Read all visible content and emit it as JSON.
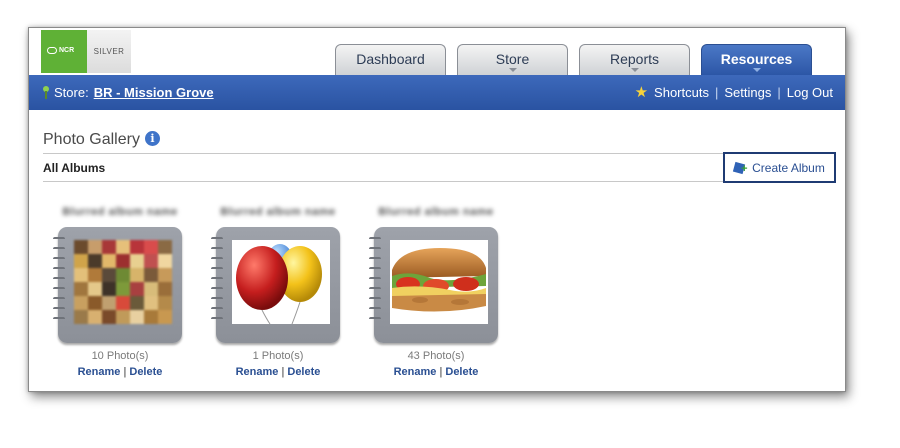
{
  "brand": {
    "logo_primary": "NCR",
    "logo_secondary": "SILVER"
  },
  "tabs": [
    {
      "label": "Dashboard",
      "active": false,
      "has_caret": false
    },
    {
      "label": "Store",
      "active": false,
      "has_caret": true
    },
    {
      "label": "Reports",
      "active": false,
      "has_caret": true
    },
    {
      "label": "Resources",
      "active": true,
      "has_caret": true
    }
  ],
  "navbar": {
    "store_label": "Store:",
    "store_name": "BR - Mission Grove",
    "shortcuts": "Shortcuts",
    "settings": "Settings",
    "logout": "Log Out",
    "separator": "|"
  },
  "page": {
    "title": "Photo Gallery",
    "section_title": "All Albums",
    "create_album": "Create Album"
  },
  "albums": [
    {
      "name": "Blurred album name",
      "count": "10 Photo(s)",
      "rename": "Rename",
      "delete": "Delete",
      "sep": "|"
    },
    {
      "name": "Blurred album name",
      "count": "1 Photo(s)",
      "rename": "Rename",
      "delete": "Delete",
      "sep": "|"
    },
    {
      "name": "Blurred album name",
      "count": "43 Photo(s)",
      "rename": "Rename",
      "delete": "Delete",
      "sep": "|"
    }
  ],
  "colors": {
    "nav_blue": "#2f5aab",
    "active_tab": "#3d69bb",
    "link_blue": "#2a4f92",
    "ncr_green": "#5fb136"
  }
}
